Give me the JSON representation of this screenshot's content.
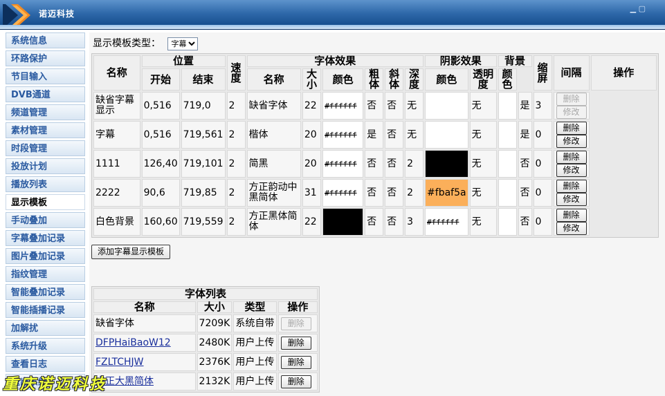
{
  "header": {
    "title": "诺迈科技",
    "brand_color": "#1d5aa0"
  },
  "sidebar": {
    "items": [
      {
        "label": "系统信息"
      },
      {
        "label": "环路保护"
      },
      {
        "label": "节目输入"
      },
      {
        "label": "DVB通道"
      },
      {
        "label": "频道管理"
      },
      {
        "label": "素材管理"
      },
      {
        "label": "时段管理"
      },
      {
        "label": "投放计划"
      },
      {
        "label": "播放列表"
      },
      {
        "label": "显示模板"
      },
      {
        "label": "手动叠加"
      },
      {
        "label": "字幕叠加记录"
      },
      {
        "label": "图片叠加记录"
      },
      {
        "label": "指纹管理"
      },
      {
        "label": "智能叠加记录"
      },
      {
        "label": "智能插播记录"
      },
      {
        "label": "加解扰"
      },
      {
        "label": "系统升级"
      },
      {
        "label": "查看日志"
      },
      {
        "label": "退出系统"
      }
    ],
    "active_index": 9
  },
  "template_type": {
    "label": "显示模板类型：",
    "selected": "字幕"
  },
  "template_table": {
    "headers": {
      "name": "名称",
      "position": "位置",
      "start": "开始",
      "end": "结束",
      "speed": "速度",
      "font_effect": "字体效果",
      "font_name": "名称",
      "size": "大小",
      "color": "颜色",
      "bold": "粗体",
      "italic": "斜体",
      "shadow_effect": "阴影效果",
      "depth": "深度",
      "shadow_color": "颜色",
      "background": "背景",
      "transparency": "透明度",
      "bg_color": "颜色",
      "scale": "缩屏",
      "interval": "间隔",
      "action": "操作"
    },
    "rows": [
      {
        "name": "缺省字幕显示",
        "start": "0,516",
        "end": "719,0",
        "speed": "2",
        "font": "缺省字体",
        "size": "22",
        "color": "#ffffff",
        "color_swatch": "",
        "bold": "否",
        "italic": "否",
        "depth": "无",
        "shadow_color": "",
        "shadow_swatch": "",
        "transparency": "无",
        "bg_color": "",
        "scale": "是",
        "interval": "3",
        "delete": "删除",
        "edit": "修改",
        "disabled": true
      },
      {
        "name": "字幕",
        "start": "0,516",
        "end": "719,561",
        "speed": "2",
        "font": "楷体",
        "size": "20",
        "color": "#ffffff",
        "color_swatch": "",
        "bold": "是",
        "italic": "否",
        "depth": "无",
        "shadow_color": "",
        "shadow_swatch": "",
        "transparency": "无",
        "bg_color": "",
        "scale": "是",
        "interval": "0",
        "delete": "删除",
        "edit": "修改",
        "disabled": false
      },
      {
        "name": "1111",
        "start": "126,40",
        "end": "719,101",
        "speed": "2",
        "font": "简黑",
        "size": "20",
        "color": "#ffffff",
        "color_swatch": "",
        "bold": "否",
        "italic": "否",
        "depth": "2",
        "shadow_color": "",
        "shadow_swatch": "#000000",
        "transparency": "无",
        "bg_color": "",
        "scale": "否",
        "interval": "0",
        "delete": "删除",
        "edit": "修改",
        "disabled": false
      },
      {
        "name": "2222",
        "start": "90,6",
        "end": "719,85",
        "speed": "2",
        "font": "方正韵动中黑简体",
        "size": "31",
        "color": "#ffffff",
        "color_swatch": "",
        "bold": "否",
        "italic": "否",
        "depth": "2",
        "shadow_color": "#fbaf5a",
        "shadow_swatch": "#fbaf5a",
        "transparency": "无",
        "bg_color": "",
        "scale": "否",
        "interval": "0",
        "delete": "删除",
        "edit": "修改",
        "disabled": false
      },
      {
        "name": "白色背景",
        "start": "160,60",
        "end": "719,559",
        "speed": "2",
        "font": "方正黑体简体",
        "size": "22",
        "color": "",
        "color_swatch": "#000000",
        "bold": "否",
        "italic": "否",
        "depth": "3",
        "shadow_color": "#ffffff",
        "shadow_swatch": "",
        "transparency": "无",
        "bg_color": "",
        "scale": "否",
        "interval": "0",
        "delete": "删除",
        "edit": "修改",
        "disabled": false
      }
    ]
  },
  "add_button": "添加字幕显示模板",
  "font_list": {
    "title": "字体列表",
    "headers": {
      "name": "名称",
      "size": "大小",
      "type": "类型",
      "action": "操作"
    },
    "rows": [
      {
        "name": "缺省字体",
        "size": "7209K",
        "type": "系统自带",
        "delete": "删除",
        "disabled": true,
        "link": false
      },
      {
        "name": "DFPHaiBaoW12",
        "size": "2480K",
        "type": "用户上传",
        "delete": "删除",
        "disabled": false,
        "link": true
      },
      {
        "name": "FZLTCHJW",
        "size": "2376K",
        "type": "用户上传",
        "delete": "删除",
        "disabled": false,
        "link": true
      },
      {
        "name": "方正大黑简体",
        "size": "2132K",
        "type": "用户上传",
        "delete": "删除",
        "disabled": false,
        "link": true
      }
    ]
  },
  "watermark": "重庆诺迈科技"
}
